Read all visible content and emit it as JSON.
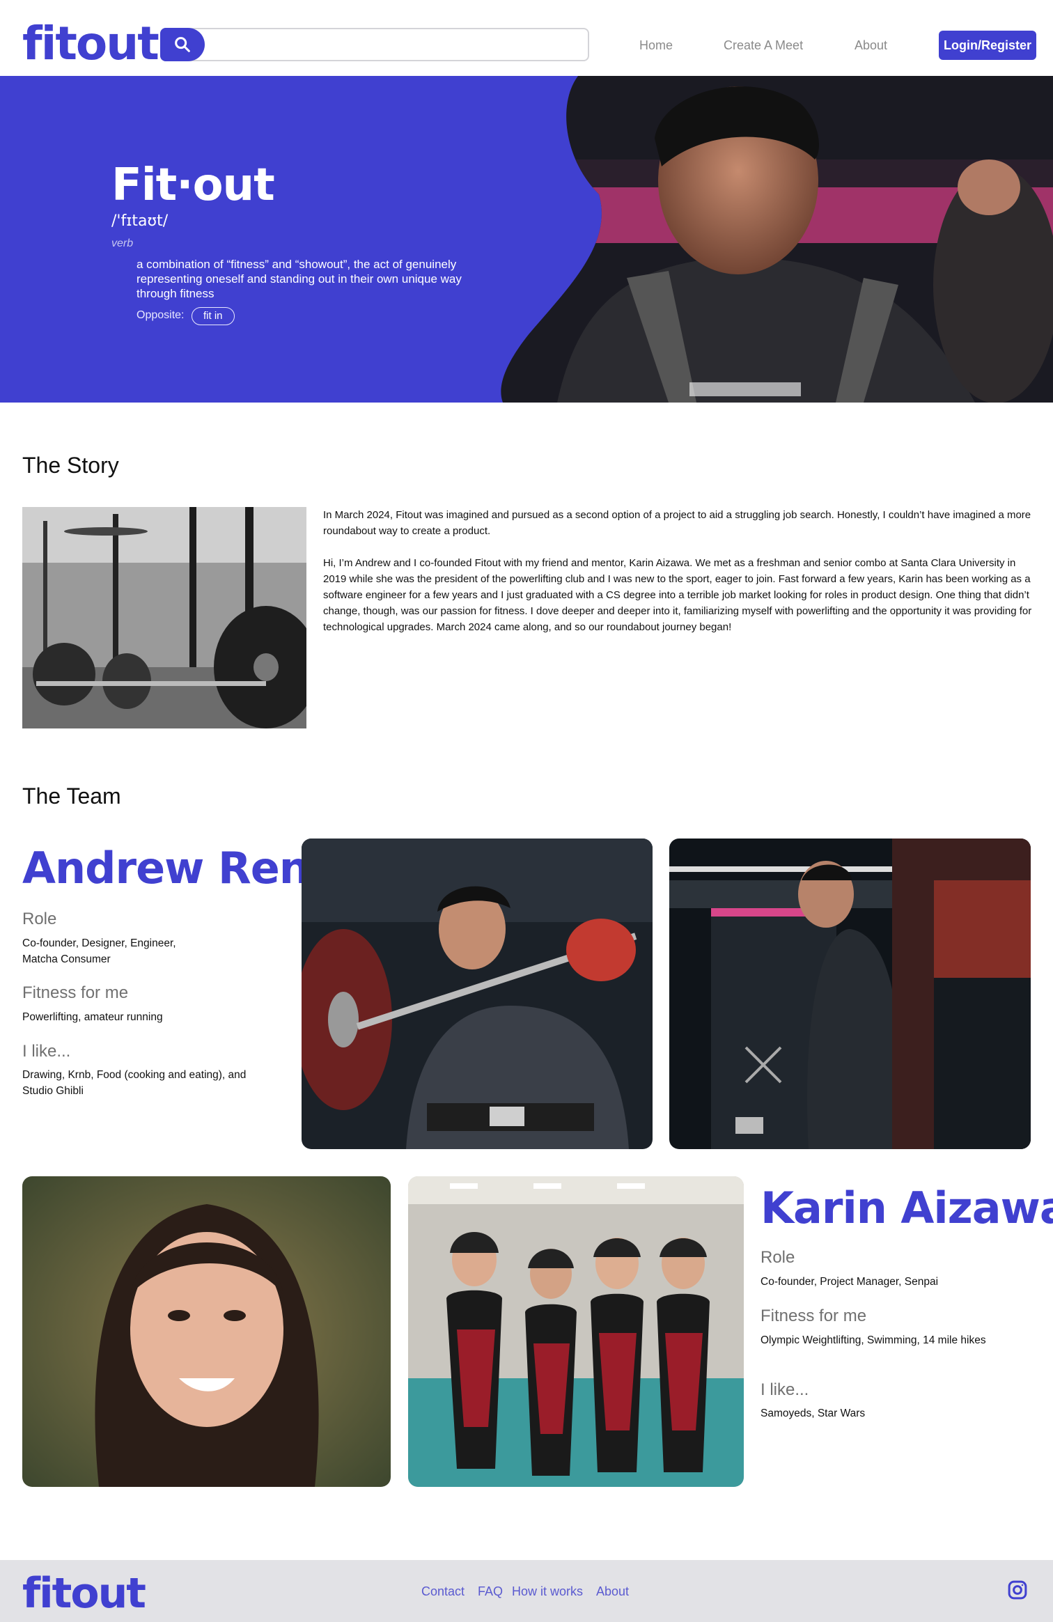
{
  "header": {
    "logo": "fitout",
    "search": {
      "placeholder": ""
    },
    "nav": [
      "Home",
      "Create A Meet",
      "About"
    ],
    "login_label": "Login/Register"
  },
  "hero": {
    "title": "Fit·out",
    "phonetic": "/'fɪtaʊt/",
    "part_of_speech": "verb",
    "definition": "a combination of “fitness” and “showout”, the act of genuinely representing oneself and standing out in their own unique way through fitness",
    "opposite_label": "Opposite:",
    "opposite_value": "fit in"
  },
  "story": {
    "title": "The Story",
    "paragraphs": [
      "In March 2024, Fitout was imagined and pursued as a second option of a project to aid a struggling job search. Honestly, I couldn’t have imagined a more roundabout way to create a product.",
      "Hi, I’m Andrew and I co-founded Fitout with my friend and mentor, Karin Aizawa. We met as a freshman and senior combo at Santa Clara University in 2019 while she was the president of the powerlifting club and I was new to the sport, eager to join. Fast forward a few years, Karin has been working as a software engineer for a few years and I just graduated with a CS degree into a terrible job market looking for roles in product design. One thing that didn’t change, though, was our passion for fitness. I dove deeper and deeper into it, familiarizing myself with powerlifting and the opportunity it was providing for technological upgrades. March 2024 came along, and so our roundabout journey began!"
    ]
  },
  "team": {
    "title": "The Team",
    "members": [
      {
        "name": "Andrew Ren",
        "role_heading": "Role",
        "role": "Co-founder, Designer, Engineer, Matcha Consumer",
        "fitness_heading": "Fitness for me",
        "fitness": "Powerlifting, amateur running",
        "likes_heading": "I like...",
        "likes": "Drawing, Krnb, Food (cooking and eating), and Studio Ghibli"
      },
      {
        "name": "Karin Aizawa",
        "role_heading": "Role",
        "role": "Co-founder, Project Manager, Senpai",
        "fitness_heading": "Fitness for me",
        "fitness": "Olympic Weightlifting, Swimming, 14 mile hikes",
        "likes_heading": "I like...",
        "likes": "Samoyeds, Star Wars"
      }
    ]
  },
  "footer": {
    "logo": "fitout",
    "links": [
      "Contact",
      "FAQ",
      "How it works",
      "About"
    ]
  },
  "colors": {
    "brand": "#4040d0",
    "footer_bg": "#e2e2e6"
  },
  "icons": [
    "search-icon",
    "instagram-icon"
  ]
}
